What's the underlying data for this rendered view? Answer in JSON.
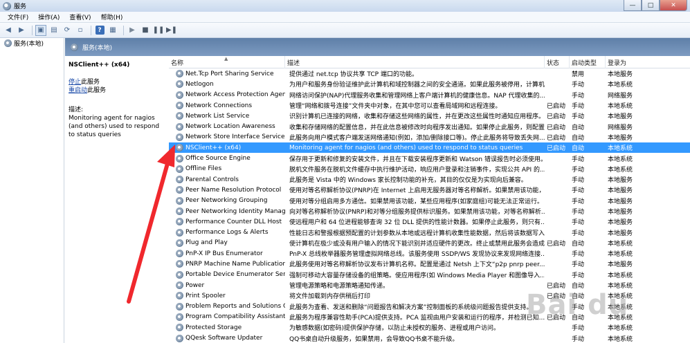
{
  "window": {
    "title": "服务"
  },
  "menu": [
    "文件(F)",
    "操作(A)",
    "查看(V)",
    "帮助(H)"
  ],
  "tree": {
    "root": "服务(本地)"
  },
  "main": {
    "header": "服务(本地)",
    "detail": {
      "title": "NSClient++ (x64)",
      "stop_link": "停止",
      "stop_suffix": "此服务",
      "restart_link": "重启动",
      "restart_suffix": "此服务",
      "desc_label": "描述:",
      "desc_text": "Monitoring agent for nagios (and others) used to respond to status queries"
    },
    "columns": [
      "名称",
      "描述",
      "状态",
      "启动类型",
      "登录为"
    ],
    "rows": [
      {
        "name": "Net.Tcp Port Sharing Service",
        "desc": "提供通过 net.tcp 协议共享 TCP 端口的功能。",
        "status": "",
        "start": "禁用",
        "logon": "本地服务"
      },
      {
        "name": "Netlogon",
        "desc": "为用户和服务身份验证维护此计算机和域控制器之间的安全通道。如果此服务被停用，计算机...",
        "status": "",
        "start": "手动",
        "logon": "本地系统"
      },
      {
        "name": "Network Access Protection Agent",
        "desc": "网络访问保护(NAP)代理服务收集和管理网络上客户端计算机的健康信息。NAP 代理收集的...",
        "status": "",
        "start": "手动",
        "logon": "网络服务"
      },
      {
        "name": "Network Connections",
        "desc": "管理“网络和拨号连接”文件夹中对象，在其中您可以查看局域网和远程连接。",
        "status": "已启动",
        "start": "手动",
        "logon": "本地系统"
      },
      {
        "name": "Network List Service",
        "desc": "识别计算机已连接的网络，收集和存储这些网络的属性，并在更改这些属性时通知应用程序。",
        "status": "已启动",
        "start": "手动",
        "logon": "本地服务"
      },
      {
        "name": "Network Location Awareness",
        "desc": "收集和存储网络的配置信息，并在此信息被修改时向程序发出通知。如果停止此服务，则配置...",
        "status": "已启动",
        "start": "自动",
        "logon": "网络服务"
      },
      {
        "name": "Network Store Interface Service",
        "desc": "此服务向用户模式客户端发送网络通知(例如，添加/删除接口等)。停止此服务将导致丢失网...",
        "status": "已启动",
        "start": "自动",
        "logon": "本地服务"
      },
      {
        "name": "NSClient++ (x64)",
        "desc": "Monitoring agent for nagios (and others) used to respond to status queries",
        "status": "已启动",
        "start": "自动",
        "logon": "本地系统",
        "selected": true
      },
      {
        "name": "Office Source Engine",
        "desc": "保存用于更新和修复的安装文件，并且在下载安装程序更新和 Watson 错误报告时必须使用。",
        "status": "",
        "start": "手动",
        "logon": "本地系统"
      },
      {
        "name": "Offline Files",
        "desc": "脱机文件服务在脱机文件缓存中执行维护活动，响应用户登录和注销事件，实现公共 API 的...",
        "status": "",
        "start": "手动",
        "logon": "本地系统"
      },
      {
        "name": "Parental Controls",
        "desc": "此服务是 Vista 中的 Windows 家长控制功能的补充，其目的仅仅是为实现向后兼容。",
        "status": "",
        "start": "手动",
        "logon": "本地服务"
      },
      {
        "name": "Peer Name Resolution Protocol",
        "desc": "使用对等名称解析协议(PNRP)在 Internet 上启用无服务器对等名称解析。如果禁用该功能，...",
        "status": "",
        "start": "手动",
        "logon": "本地服务"
      },
      {
        "name": "Peer Networking Grouping",
        "desc": "使用对等分组启用多方通信。如果禁用该功能，某些应用程序(如家庭组)可能无法正常运行。",
        "status": "",
        "start": "手动",
        "logon": "本地服务"
      },
      {
        "name": "Peer Networking Identity Manager",
        "desc": "向对等名称解析协议(PNRP)和对等分组服务提供标识服务。如果禁用该功能，对等名称解析...",
        "status": "",
        "start": "手动",
        "logon": "本地服务"
      },
      {
        "name": "Performance Counter DLL Host",
        "desc": "使远程用户和 64 位进程能够查询 32 位 DLL 提供的性能计数器。如果停止此服务，则只有...",
        "status": "",
        "start": "手动",
        "logon": "本地服务"
      },
      {
        "name": "Performance Logs & Alerts",
        "desc": "性能日志和警报根据预配置的计划参数从本地或远程计算机收集性能数据，然后将该数据写入...",
        "status": "",
        "start": "手动",
        "logon": "本地服务"
      },
      {
        "name": "Plug and Play",
        "desc": "使计算机在极少或没有用户输入的情况下能识别并适应硬件的更改。终止或禁用此服务会造成...",
        "status": "已启动",
        "start": "自动",
        "logon": "本地系统"
      },
      {
        "name": "PnP-X IP Bus Enumerator",
        "desc": "PnP-X 总线枚举器服务管理虚拟网络总线。该服务使用 SSDP/WS 发现协议来发现网络连接...",
        "status": "",
        "start": "手动",
        "logon": "本地系统"
      },
      {
        "name": "PNRP Machine Name Publication ...",
        "desc": "此服务使用对等名称解析协议发布计算机名称。配置是通过 Netsh 上下文“p2p pnrp peer...",
        "status": "",
        "start": "手动",
        "logon": "本地服务"
      },
      {
        "name": "Portable Device Enumerator Servi...",
        "desc": "强制可移动大容量存储设备的组策略。使应用程序(如 Windows Media Player 和图像导入...",
        "status": "",
        "start": "手动",
        "logon": "本地系统"
      },
      {
        "name": "Power",
        "desc": "管理电源策略和电源策略通知传递。",
        "status": "已启动",
        "start": "自动",
        "logon": "本地系统"
      },
      {
        "name": "Print Spooler",
        "desc": "将文件加载到内存供稍后打印",
        "status": "已启动",
        "start": "自动",
        "logon": "本地系统"
      },
      {
        "name": "Problem Reports and Solutions C...",
        "desc": "此服务为查看、发送和删除“问题报告和解决方案”控制面板的系统级问题报告提供支持。",
        "status": "",
        "start": "手动",
        "logon": "本地系统"
      },
      {
        "name": "Program Compatibility Assistant ...",
        "desc": "此服务为程序兼容性助手(PCA)提供支持。PCA 监视由用户安装和运行的程序，并检测已知...",
        "status": "已启动",
        "start": "自动",
        "logon": "本地系统"
      },
      {
        "name": "Protected Storage",
        "desc": "为敏感数据(如密码)提供保护存储，以防止未授权的服务、进程或用户访问。",
        "status": "",
        "start": "手动",
        "logon": "本地系统"
      },
      {
        "name": "QQesk Software Updater",
        "desc": "QQ书桌自动升级服务，如果禁用，会导致QQ书桌不能升级。",
        "status": "",
        "start": "手动",
        "logon": "本地系统"
      }
    ]
  },
  "watermark": {
    "text": "Bai du"
  },
  "colors": {
    "selected": "#3399ff",
    "header": "#6f8fb7",
    "annotation": "#f0282d"
  }
}
